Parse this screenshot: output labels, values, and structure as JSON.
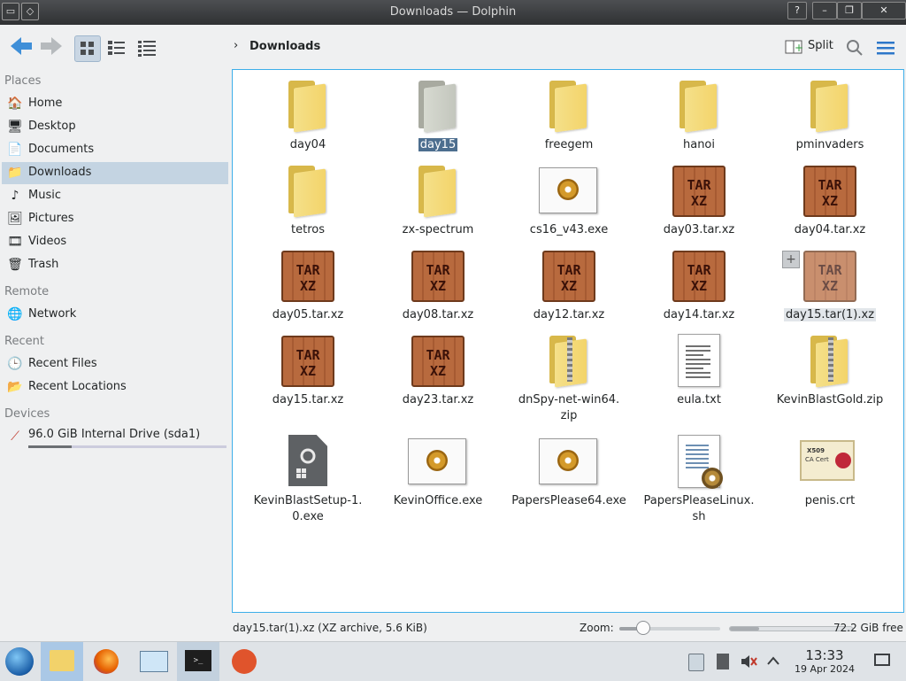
{
  "window": {
    "title": "Downloads — Dolphin"
  },
  "toolbar": {
    "breadcrumb": "Downloads",
    "split_label": "Split"
  },
  "sidebar": {
    "sections": {
      "places": "Places",
      "remote": "Remote",
      "recent": "Recent",
      "devices": "Devices"
    },
    "places": [
      {
        "label": "Home",
        "icon": "home-icon"
      },
      {
        "label": "Desktop",
        "icon": "desktop-icon"
      },
      {
        "label": "Documents",
        "icon": "documents-icon"
      },
      {
        "label": "Downloads",
        "icon": "downloads-icon",
        "selected": true
      },
      {
        "label": "Music",
        "icon": "music-icon"
      },
      {
        "label": "Pictures",
        "icon": "pictures-icon"
      },
      {
        "label": "Videos",
        "icon": "videos-icon"
      },
      {
        "label": "Trash",
        "icon": "trash-icon"
      }
    ],
    "remote": [
      {
        "label": "Network",
        "icon": "network-icon"
      }
    ],
    "recent": [
      {
        "label": "Recent Files",
        "icon": "recent-files-icon"
      },
      {
        "label": "Recent Locations",
        "icon": "recent-locations-icon"
      }
    ],
    "devices": [
      {
        "label": "96.0 GiB Internal Drive (sda1)",
        "icon": "drive-icon",
        "used_fraction": 0.22
      }
    ]
  },
  "files": [
    {
      "name": "day04",
      "type": "folder"
    },
    {
      "name": "day15",
      "type": "folder-grey",
      "selected": true
    },
    {
      "name": "freegem",
      "type": "folder"
    },
    {
      "name": "hanoi",
      "type": "folder"
    },
    {
      "name": "pminvaders",
      "type": "folder"
    },
    {
      "name": "tetros",
      "type": "folder"
    },
    {
      "name": "zx-spectrum",
      "type": "folder"
    },
    {
      "name": "cs16_v43.exe",
      "type": "exe"
    },
    {
      "name": "day03.tar.xz",
      "type": "archive"
    },
    {
      "name": "day04.tar.xz",
      "type": "archive"
    },
    {
      "name": "day05.tar.xz",
      "type": "archive"
    },
    {
      "name": "day08.tar.xz",
      "type": "archive"
    },
    {
      "name": "day12.tar.xz",
      "type": "archive"
    },
    {
      "name": "day14.tar.xz",
      "type": "archive"
    },
    {
      "name": "day15.tar(1).xz",
      "type": "archive",
      "hovered": true
    },
    {
      "name": "day15.tar.xz",
      "type": "archive"
    },
    {
      "name": "day23.tar.xz",
      "type": "archive"
    },
    {
      "name": "dnSpy-net-win64.",
      "name2": "zip",
      "type": "zip"
    },
    {
      "name": "eula.txt",
      "type": "text"
    },
    {
      "name": "KevinBlastGold.zip",
      "type": "zip"
    },
    {
      "name": "KevinBlastSetup-1.",
      "name2": "0.exe",
      "type": "setup"
    },
    {
      "name": "KevinOffice.exe",
      "type": "exe"
    },
    {
      "name": "PapersPlease64.exe",
      "type": "exe"
    },
    {
      "name": "PapersPleaseLinux.",
      "name2": "sh",
      "type": "script"
    },
    {
      "name": "penis.crt",
      "type": "cert"
    }
  ],
  "icon_text": {
    "archive_top": "TAR",
    "archive_bottom": "XZ",
    "cert_top": "X509",
    "cert_bottom": "CA Cert"
  },
  "statusbar": {
    "info": "day15.tar(1).xz (XZ archive, 5.6 KiB)",
    "zoom_label": "Zoom:",
    "zoom_fraction": 0.24,
    "free_space": "72.2 GiB free",
    "used_fraction": 0.24
  },
  "taskbar": {
    "time": "13:33",
    "date": "19 Apr 2024"
  }
}
